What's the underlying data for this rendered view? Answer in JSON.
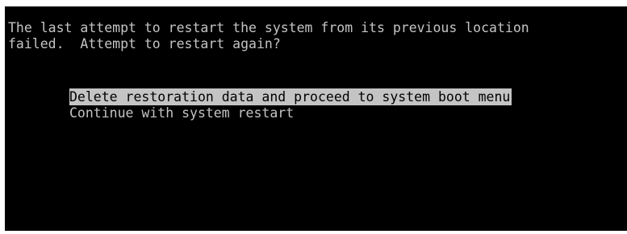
{
  "message": {
    "line1": "The last attempt to restart the system from its previous location",
    "line2": "failed.  Attempt to restart again?"
  },
  "menu": {
    "options": [
      {
        "label": "Delete restoration data and proceed to system boot menu",
        "selected": true
      },
      {
        "label": "Continue with system restart",
        "selected": false
      }
    ]
  },
  "colors": {
    "background": "#000000",
    "text": "#c4c4c4",
    "highlight_bg": "#c4c4c4",
    "highlight_text": "#000000"
  }
}
